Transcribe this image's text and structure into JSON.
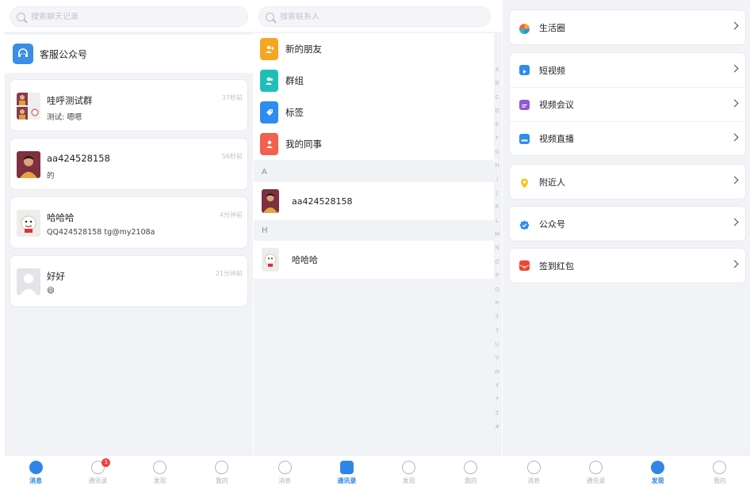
{
  "chats_panel": {
    "search_placeholder": "搜索聊天记录",
    "service_account": "客服公众号",
    "conversations": [
      {
        "title": "哇呼测试群",
        "message": "测试: 嗯嗯",
        "time": "37秒前"
      },
      {
        "title": "aa424528158",
        "message": "的",
        "time": "56秒前"
      },
      {
        "title": "哈哈哈",
        "message": "QQ424528158 tg@my2108a",
        "time": "4分钟前"
      },
      {
        "title": "好好",
        "message": "😄",
        "time": "21分钟前"
      }
    ]
  },
  "contacts_panel": {
    "search_placeholder": "搜索联系人",
    "categories": [
      {
        "label": "新的朋友",
        "color": "#f5a623"
      },
      {
        "label": "群组",
        "color": "#1fbfb8"
      },
      {
        "label": "标签",
        "color": "#2d8cf0"
      },
      {
        "label": "我的同事",
        "color": "#f3604b"
      }
    ],
    "sections": [
      {
        "letter": "A",
        "contacts": [
          "aa424528158"
        ]
      },
      {
        "letter": "H",
        "contacts": [
          "哈哈哈"
        ]
      }
    ],
    "alphabet": [
      "A",
      "B",
      "C",
      "D",
      "E",
      "F",
      "G",
      "H",
      "I",
      "J",
      "K",
      "L",
      "M",
      "N",
      "O",
      "P",
      "Q",
      "R",
      "S",
      "T",
      "U",
      "V",
      "W",
      "X",
      "Y",
      "Z",
      "#"
    ]
  },
  "discover_panel": {
    "groups": [
      [
        {
          "label": "生活圈",
          "icon": "pinwheel-icon"
        }
      ],
      [
        {
          "label": "短视频",
          "icon": "play-icon"
        },
        {
          "label": "视频会议",
          "icon": "meeting-icon"
        },
        {
          "label": "视频直播",
          "icon": "live-icon"
        }
      ],
      [
        {
          "label": "附近人",
          "icon": "location-icon"
        }
      ],
      [
        {
          "label": "公众号",
          "icon": "verified-icon"
        }
      ],
      [
        {
          "label": "签到红包",
          "icon": "red-packet-icon"
        }
      ]
    ]
  },
  "tabbar": {
    "tabs": [
      "消息",
      "通讯录",
      "发现",
      "我的"
    ],
    "unread_badge": "1",
    "accent": "#2f86e8"
  }
}
